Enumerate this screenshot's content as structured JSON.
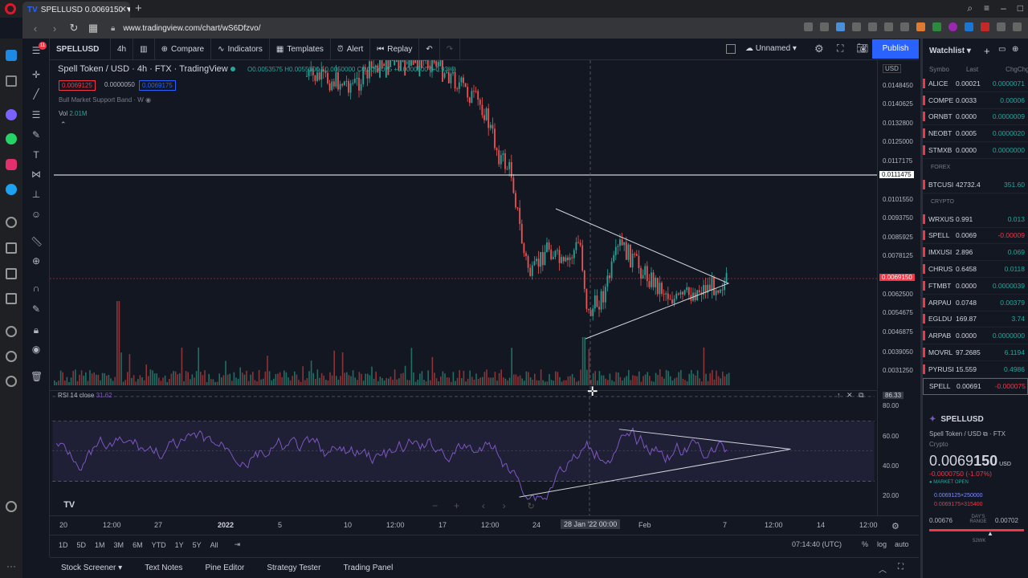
{
  "browser": {
    "tab_title": "SPELLUSD 0.0069150 ▼ −1.0",
    "url": "www.tradingview.com/chart/wS6Dfzvo/"
  },
  "toolbar": {
    "symbol": "SPELLUSD",
    "interval": "4h",
    "compare": "Compare",
    "indicators": "Indicators",
    "templates": "Templates",
    "alert": "Alert",
    "replay": "Replay",
    "layout_name": "Unnamed",
    "publish": "Publish"
  },
  "legend": {
    "title": "Spell Token / USD · 4h · FTX · TradingView",
    "ohlc": "O0.0053575 H0.0055300 L0.0050000 C0.0054075 +0.0000500 (+0.93%)",
    "bid": "0.0069125",
    "spread": "0.0000050",
    "ask": "0.0069175",
    "indicator1": "Bull Market Support Band · W",
    "volume_label": "Vol",
    "volume_value": "2.01M",
    "rsi_label": "RSI 14 close",
    "rsi_value": "31.62"
  },
  "price_axis": {
    "currency": "USD",
    "ticks": [
      "0.0148450",
      "0.0140625",
      "0.0132800",
      "0.0125000",
      "0.0117175",
      "0.0101550",
      "0.0093750",
      "0.0085925",
      "0.0078125",
      "0.0062500",
      "0.0054675",
      "0.0046875",
      "0.0039050",
      "0.0031250"
    ],
    "hline_label": "0.0111475",
    "current_price": "0.0069150"
  },
  "rsi_axis": {
    "ticks": [
      "80.00",
      "60.00",
      "40.00",
      "20.00"
    ],
    "crosshair": "86.33"
  },
  "time_axis": {
    "ticks": [
      "20",
      "12:00",
      "27",
      "2022",
      "5",
      "10",
      "12:00",
      "17",
      "12:00",
      "24",
      "28 Jan '22  00:00",
      "Feb",
      "7",
      "12:00",
      "14",
      "12:00"
    ]
  },
  "range_bar": {
    "ranges": [
      "1D",
      "5D",
      "1M",
      "3M",
      "6M",
      "YTD",
      "1Y",
      "5Y",
      "All"
    ],
    "clock": "07:14:40 (UTC)",
    "pct": "%",
    "log": "log",
    "auto": "auto"
  },
  "bottom_tabs": [
    "Stock Screener",
    "Text Notes",
    "Pine Editor",
    "Strategy Tester",
    "Trading Panel"
  ],
  "watchlist": {
    "title": "Watchlist",
    "cols": [
      "Symbo",
      "Last",
      "Chg",
      "Chg"
    ],
    "group1": [
      {
        "sym": "ALICE",
        "last": "0.00021",
        "chg": "0.0000071",
        "dir": "pos"
      },
      {
        "sym": "COMPE",
        "last": "0.0033",
        "chg": "0.00006",
        "dir": "pos"
      },
      {
        "sym": "ORNBT",
        "last": "0.0000",
        "chg": "0.0000009",
        "dir": "pos"
      },
      {
        "sym": "NEOBT",
        "last": "0.0005",
        "chg": "0.0000020",
        "dir": "pos"
      },
      {
        "sym": "STMXB",
        "last": "0.0000",
        "chg": "0.0000000",
        "dir": "pos"
      }
    ],
    "forex_label": "FOREX",
    "forex": [
      {
        "sym": "BTCUSI",
        "last": "42732.4",
        "chg": "351.60",
        "dir": "pos"
      }
    ],
    "crypto_label": "CRYPTO",
    "crypto": [
      {
        "sym": "WRXUS",
        "last": "0.991",
        "chg": "0.013",
        "dir": "pos"
      },
      {
        "sym": "SPELL",
        "last": "0.0069",
        "chg": "-0.00009",
        "dir": "neg"
      },
      {
        "sym": "IMXUSI",
        "last": "2.896",
        "chg": "0.069",
        "dir": "pos"
      },
      {
        "sym": "CHRUS",
        "last": "0.6458",
        "chg": "0.0118",
        "dir": "pos"
      },
      {
        "sym": "FTMBT",
        "last": "0.0000",
        "chg": "0.0000039",
        "dir": "pos"
      },
      {
        "sym": "ARPAU",
        "last": "0.0748",
        "chg": "0.00379",
        "dir": "pos"
      },
      {
        "sym": "EGLDU",
        "last": "169.87",
        "chg": "3.74",
        "dir": "pos"
      },
      {
        "sym": "ARPAB",
        "last": "0.0000",
        "chg": "0.0000000",
        "dir": "pos"
      },
      {
        "sym": "MOVRL",
        "last": "97.2685",
        "chg": "6.1194",
        "dir": "pos"
      },
      {
        "sym": "PYRUSI",
        "last": "15.559",
        "chg": "0.4986",
        "dir": "pos"
      },
      {
        "sym": "SPELL",
        "last": "0.00691",
        "chg": "-0.000075",
        "dir": "neg"
      }
    ]
  },
  "details": {
    "symbol": "SPELLUSD",
    "name": "Spell Token / USD",
    "exchange": "FTX",
    "category": "Crypto",
    "price_main": "0.0069",
    "price_tail": "150",
    "currency": "USD",
    "change": "-0.0000750 (-1.07%)",
    "market": "MARKET OPEN",
    "bid_line": "0.0069125×250000",
    "ask_line": "0.0069175×315400",
    "range_low": "0.00676",
    "range_high": "0.00702",
    "range_label": "DAY'S RANGE",
    "week_label": "52WK"
  }
}
